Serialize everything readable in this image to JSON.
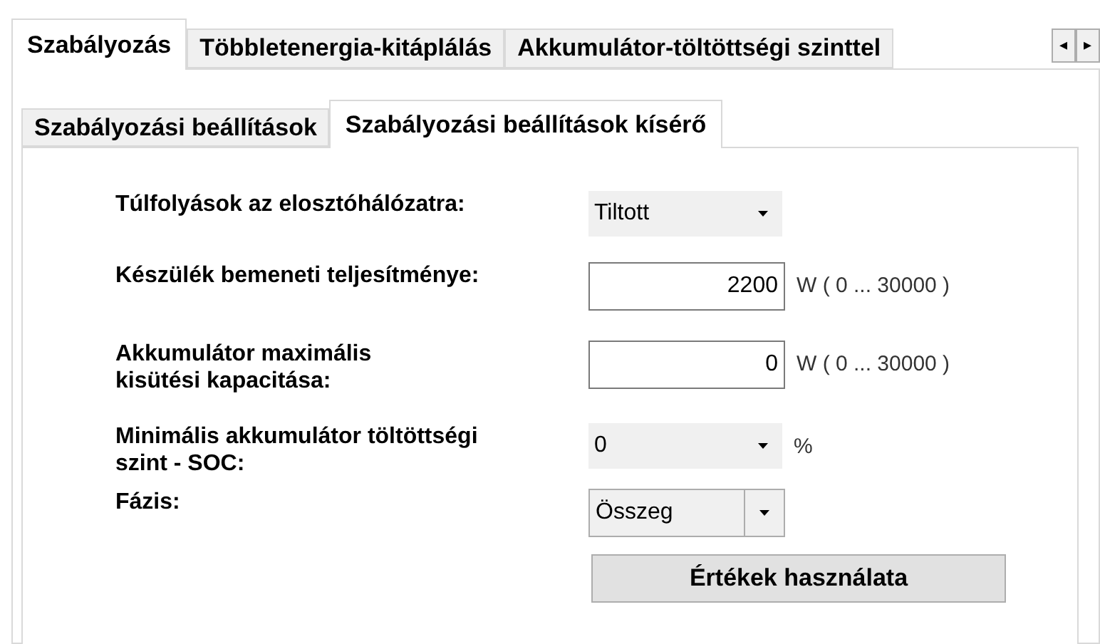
{
  "tabs": [
    {
      "label": "Szabályozás",
      "selected": true
    },
    {
      "label": "Többletenergia-kitáplálás",
      "selected": false
    },
    {
      "label": "Akkumulátor-töltöttségi szinttel",
      "selected": false
    }
  ],
  "tab_scroll": [
    "◂",
    "▸"
  ],
  "subtabs": [
    {
      "label": "Szabályozási beállítások",
      "selected": false
    },
    {
      "label": "Szabályozási beállítások kísérő",
      "selected": true
    }
  ],
  "fields": [
    {
      "label": "Túlfolyások az elosztóhálózatra:",
      "kind": "flat-dropdown",
      "value": "Tiltott"
    },
    {
      "label": "Készülék bemeneti teljesítménye:",
      "kind": "number",
      "value": "2200",
      "unit": "W ( 0 ... 30000 )"
    },
    {
      "label": "Akkumulátor maximális\nkisütési kapacitása:",
      "kind": "number",
      "value": "0",
      "unit": "W ( 0 ... 30000 )"
    },
    {
      "label": "Minimális akkumulátor töltöttségi\nszint - SOC:",
      "kind": "flat-dropdown",
      "value": "0",
      "unit": "%"
    },
    {
      "label": "Fázis:",
      "kind": "dropdown",
      "value": "Összeg"
    }
  ],
  "apply_button": "Értékek használata"
}
